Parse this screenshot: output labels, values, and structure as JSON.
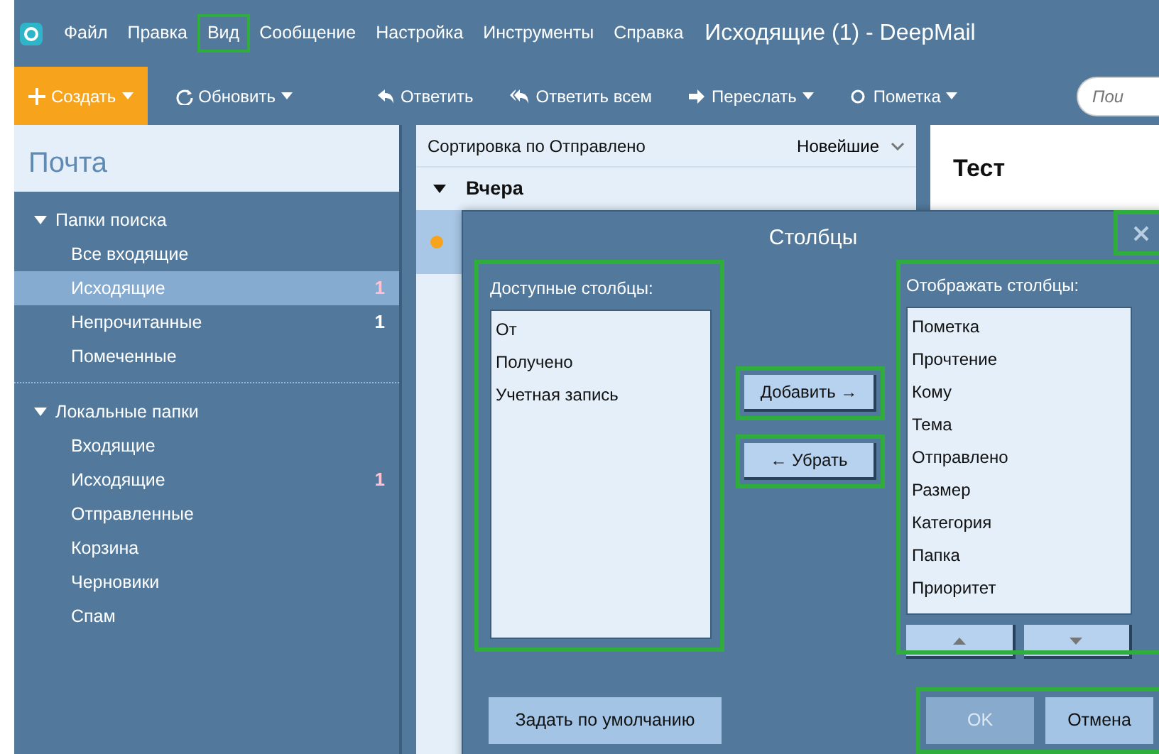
{
  "app": {
    "title": "Исходящие (1) - DeepMail"
  },
  "menu": [
    {
      "label": "Файл",
      "highlighted": false
    },
    {
      "label": "Правка",
      "highlighted": false
    },
    {
      "label": "Вид",
      "highlighted": true
    },
    {
      "label": "Сообщение",
      "highlighted": false
    },
    {
      "label": "Настройка",
      "highlighted": false
    },
    {
      "label": "Инструменты",
      "highlighted": false
    },
    {
      "label": "Справка",
      "highlighted": false
    }
  ],
  "toolbar": {
    "buttons": [
      {
        "label": "Создать",
        "kind": "new",
        "dropdown": true
      },
      {
        "label": "Обновить",
        "kind": "refresh",
        "dropdown": true
      },
      {
        "label": "Ответить",
        "kind": "reply",
        "dropdown": false
      },
      {
        "label": "Ответить всем",
        "kind": "reply-all",
        "dropdown": false
      },
      {
        "label": "Переслать",
        "kind": "forward",
        "dropdown": true
      },
      {
        "label": "Пометка",
        "kind": "flag",
        "dropdown": true
      }
    ],
    "search": {
      "placeholder": "Пои"
    }
  },
  "sidebar": {
    "title": "Почта",
    "groups": [
      {
        "label": "Папки поиска",
        "expanded": true,
        "children": [
          {
            "label": "Все входящие",
            "selected": false
          },
          {
            "label": "Исходящие",
            "selected": true,
            "count": "1",
            "color": "#ffc2d4"
          },
          {
            "label": "Непрочитанные",
            "selected": false,
            "count": "1",
            "color": "#ffffff"
          },
          {
            "label": "Помеченные",
            "selected": false
          }
        ]
      },
      {
        "label": "Локальные папки",
        "expanded": true,
        "children": [
          {
            "label": "Входящие",
            "selected": false
          },
          {
            "label": "Исходящие",
            "selected": false,
            "count": "1",
            "color": "#ffc2d4"
          },
          {
            "label": "Отправленные",
            "selected": false
          },
          {
            "label": "Корзина",
            "selected": false
          },
          {
            "label": "Черновики",
            "selected": false
          },
          {
            "label": "Спам",
            "selected": false
          }
        ]
      }
    ]
  },
  "message_list": {
    "sort_label": "Сортировка по Отправлено",
    "order": "Новейшие",
    "groups": [
      {
        "label": "Вчера",
        "expanded": true,
        "rows": [
          {
            "unread": true,
            "selected": true
          }
        ]
      }
    ]
  },
  "preview": {
    "subject": "Тест"
  },
  "dialog": {
    "title": "Столбцы",
    "close_highlighted": true,
    "available": {
      "label": "Доступные столбцы:",
      "highlighted": true,
      "items": [
        "От",
        "Получено",
        "Учетная запись"
      ]
    },
    "actions": [
      {
        "label": "Добавить →",
        "highlighted": true
      },
      {
        "label": "← Убрать",
        "highlighted": true
      }
    ],
    "shown": {
      "label": "Отображать столбцы:",
      "highlighted": true,
      "items": [
        "Пометка",
        "Прочтение",
        "Кому",
        "Тема",
        "Отправлено",
        "Размер",
        "Категория",
        "Папка",
        "Приоритет"
      ]
    },
    "default_button": {
      "label": "Задать по умолчанию",
      "highlighted": false
    },
    "footer_highlighted": true,
    "footer_buttons": [
      {
        "label": "OK",
        "disabled": true
      },
      {
        "label": "Отмена",
        "disabled": false
      }
    ]
  }
}
